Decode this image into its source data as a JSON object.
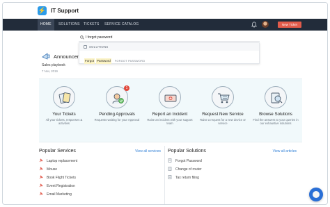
{
  "app": {
    "title": "IT Support",
    "logo_glyph": "⚡"
  },
  "nav": {
    "items": [
      "HOME",
      "SOLUTIONS",
      "TICKETS",
      "SERVICE CATALOG"
    ],
    "active": "HOME",
    "new_ticket_label": "New Ticket"
  },
  "search": {
    "value": "I forgot password",
    "dropdown_header": "SOLUTIONS",
    "result_words": [
      "Forgot",
      "Password"
    ],
    "result_tag": "FORGOT PASSWORD"
  },
  "announcements": {
    "title": "Announcem",
    "item": "Sales playbook",
    "date": "7 Nov, 2019"
  },
  "cards": [
    {
      "icon": "tickets-icon",
      "title": "Your Tickets",
      "desc": "All your tickets, responses & activities"
    },
    {
      "icon": "approvals-icon",
      "title": "Pending Approvals",
      "desc": "Requests waiting for your Approval",
      "badge": "1"
    },
    {
      "icon": "incident-icon",
      "title": "Report an Incident",
      "desc": "Raise an incident with your support team"
    },
    {
      "icon": "cart-icon",
      "title": "Request New Service",
      "desc": "Raise a request for a new device or service"
    },
    {
      "icon": "solutions-icon",
      "title": "Browse Solutions",
      "desc": "Find the answers to your queries in our exhaustive solutions"
    }
  ],
  "popular_services": {
    "title": "Popular Services",
    "link": "View all services",
    "items": [
      "Laptop replacement",
      "Mouse",
      "Book Flight Tickets",
      "Event Registration",
      "Email Marketing"
    ]
  },
  "popular_solutions": {
    "title": "Popular Solutions",
    "link": "View all articles",
    "items": [
      "Forgot Password",
      "Change of router",
      "Tax return filing"
    ]
  },
  "colors": {
    "navbar": "#222c3a",
    "accent": "#2c9be8",
    "new_ticket": "#e15b4b",
    "link": "#2f7fd6",
    "band": "#f1f9fb"
  }
}
